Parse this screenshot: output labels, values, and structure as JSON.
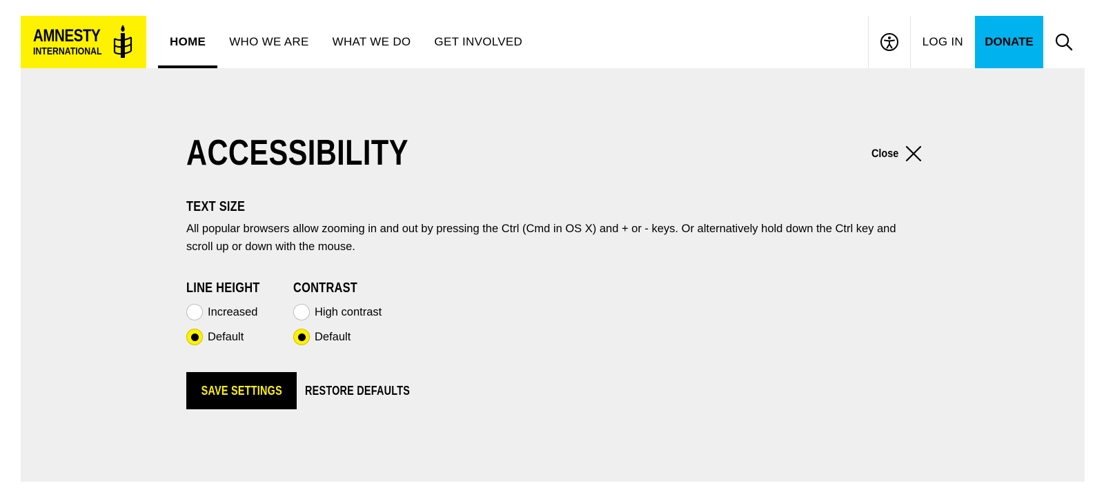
{
  "header": {
    "logo": {
      "line1": "AMNESTY",
      "line2": "INTERNATIONAL"
    },
    "nav": [
      {
        "label": "HOME",
        "active": true
      },
      {
        "label": "WHO WE ARE"
      },
      {
        "label": "WHAT WE DO"
      },
      {
        "label": "GET INVOLVED"
      }
    ],
    "login_label": "LOG IN",
    "donate_label": "DONATE",
    "icons": [
      "accessibility-icon",
      "search-icon"
    ],
    "colors": {
      "brand_yellow": "#fff200",
      "donate_blue": "#00b3ee"
    }
  },
  "panel": {
    "title": "ACCESSIBILITY",
    "close_label": "Close",
    "text_size": {
      "heading": "TEXT SIZE",
      "description": "All popular browsers allow zooming in and out by pressing the Ctrl (Cmd in OS X) and + or - keys. Or alternatively hold down the Ctrl key and scroll up or down with the mouse."
    },
    "line_height": {
      "heading": "LINE HEIGHT",
      "options": [
        {
          "label": "Increased",
          "selected": false
        },
        {
          "label": "Default",
          "selected": true
        }
      ]
    },
    "contrast": {
      "heading": "CONTRAST",
      "options": [
        {
          "label": "High contrast",
          "selected": false
        },
        {
          "label": "Default",
          "selected": true
        }
      ]
    },
    "save_label": "SAVE SETTINGS",
    "restore_label": "RESTORE DEFAULTS"
  }
}
